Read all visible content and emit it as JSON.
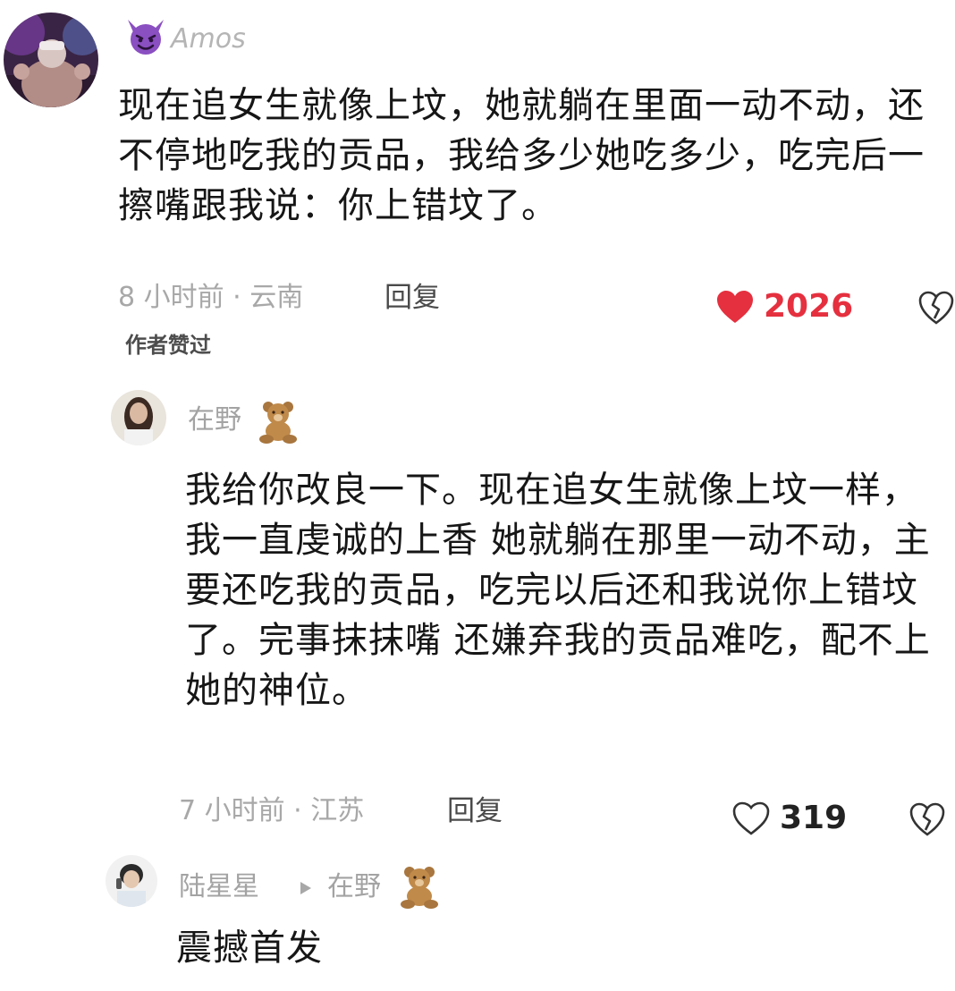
{
  "comments": [
    {
      "username": "Amos",
      "badge_icon": "devil-emoji-icon",
      "text": "现在追女生就像上坟，她就躺在里面一动不动，还不停地吃我的贡品，我给多少她吃多少，吃完后一擦嘴跟我说：你上错坟了。",
      "time_location": "8 小时前 · 云南",
      "reply_label": "回复",
      "like_count": "2026",
      "liked": true,
      "like_color": "#e5303f",
      "author_liked_label": "作者赞过"
    },
    {
      "username": "在野",
      "badge_icon": "teddy-bear-icon",
      "text": "我给你改良一下。现在追女生就像上坟一样，我一直虔诚的上香 她就躺在那里一动不动，主要还吃我的贡品，吃完以后还和我说你上错坟了。完事抹抹嘴 还嫌弃我的贡品难吃，配不上她的神位。",
      "time_location": "7 小时前 · 江苏",
      "reply_label": "回复",
      "like_count": "319",
      "liked": false
    },
    {
      "username": "陆星星",
      "reply_to": "在野",
      "badge_icon": "teddy-bear-icon",
      "text": "震撼首发"
    }
  ]
}
